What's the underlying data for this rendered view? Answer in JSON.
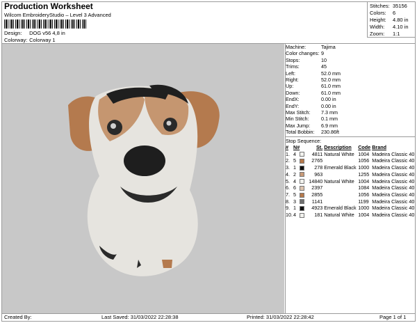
{
  "header": {
    "title": "Production Worksheet",
    "subtitle": "Wilcom EmbroideryStudio – Level 3 Advanced",
    "design_label": "Design:",
    "design_value": "DOG v56 4,8 in",
    "colorway_label": "Colorway:",
    "colorway_value": "Colorway 1"
  },
  "stats": [
    {
      "label": "Stitches:",
      "value": "35156"
    },
    {
      "label": "Colors:",
      "value": "6"
    },
    {
      "label": "Height:",
      "value": "4.80 in"
    },
    {
      "label": "Width:",
      "value": "4.10 in"
    },
    {
      "label": "Zoom:",
      "value": "1:1"
    }
  ],
  "machine_info": [
    {
      "label": "Machine:",
      "value": "Tajima"
    },
    {
      "label": "Color changes:",
      "value": "9"
    },
    {
      "label": "Stops:",
      "value": "10"
    },
    {
      "label": "Trims:",
      "value": "45"
    },
    {
      "label": "Left:",
      "value": "52.0 mm"
    },
    {
      "label": "Right:",
      "value": "52.0 mm"
    },
    {
      "label": "Up:",
      "value": "61.0 mm"
    },
    {
      "label": "Down:",
      "value": "61.0 mm"
    },
    {
      "label": "EndX:",
      "value": "0.00 in"
    },
    {
      "label": "EndY:",
      "value": "0.00 in"
    },
    {
      "label": "Max Stitch:",
      "value": "7.3 mm"
    },
    {
      "label": "Min Stitch:",
      "value": "0.1 mm"
    },
    {
      "label": "Max Jump:",
      "value": "6.9 mm"
    },
    {
      "label": "Total Bobbin:",
      "value": "230.86ft"
    }
  ],
  "stop_sequence": {
    "heading": "Stop Sequence:",
    "columns": [
      "#",
      "N#",
      "St.",
      "Description",
      "Code",
      "Brand"
    ],
    "rows": [
      {
        "num": "1.",
        "n": "4",
        "color": "#f2f2ee",
        "st": "4811",
        "desc": "Natural White",
        "code": "1004",
        "brand": "Madeira Classic 40"
      },
      {
        "num": "2.",
        "n": "5",
        "color": "#b77a4c",
        "st": "2765",
        "desc": "",
        "code": "1056",
        "brand": "Madeira Classic 40"
      },
      {
        "num": "3.",
        "n": "1",
        "color": "#101010",
        "st": "278",
        "desc": "Emerald Black",
        "code": "1000",
        "brand": "Madeira Classic 40"
      },
      {
        "num": "4.",
        "n": "2",
        "color": "#c89a78",
        "st": "963",
        "desc": "",
        "code": "1255",
        "brand": "Madeira Classic 40"
      },
      {
        "num": "5.",
        "n": "4",
        "color": "#f2f2ee",
        "st": "14840",
        "desc": "Natural White",
        "code": "1004",
        "brand": "Madeira Classic 40"
      },
      {
        "num": "6.",
        "n": "6",
        "color": "#dcc3ae",
        "st": "2397",
        "desc": "",
        "code": "1084",
        "brand": "Madeira Classic 40"
      },
      {
        "num": "7.",
        "n": "5",
        "color": "#b77a4c",
        "st": "2855",
        "desc": "",
        "code": "1056",
        "brand": "Madeira Classic 40"
      },
      {
        "num": "8.",
        "n": "3",
        "color": "#6f6f6f",
        "st": "1141",
        "desc": "",
        "code": "1199",
        "brand": "Madeira Classic 40"
      },
      {
        "num": "9.",
        "n": "1",
        "color": "#101010",
        "st": "4923",
        "desc": "Emerald Black",
        "code": "1000",
        "brand": "Madeira Classic 40"
      },
      {
        "num": "10.",
        "n": "4",
        "color": "#f2f2ee",
        "st": "181",
        "desc": "Natural White",
        "code": "1004",
        "brand": "Madeira Classic 40"
      }
    ]
  },
  "footer": {
    "created_by": "Created By:",
    "last_saved": "Last Saved: 31/03/2022 22:28:38",
    "printed": "Printed: 31/03/2022 22:28:42",
    "page": "Page 1 of 1"
  }
}
